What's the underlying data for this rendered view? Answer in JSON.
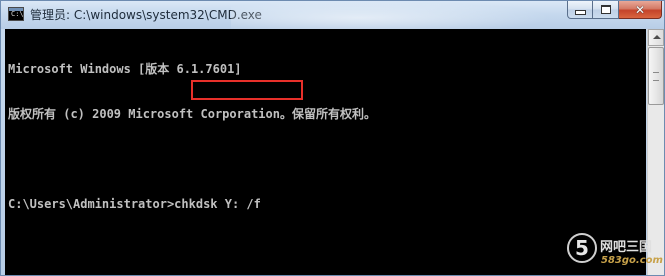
{
  "window": {
    "title": "管理员: C:\\windows\\system32\\CMD.exe",
    "icon": "cmd-icon",
    "icon_text": "C:\\"
  },
  "caption_buttons": {
    "minimize_icon": "minimize-icon",
    "maximize_icon": "maximize-icon",
    "close_icon": "close-icon",
    "close_label": "✕"
  },
  "console": {
    "lines": [
      "Microsoft Windows [版本 6.1.7601]",
      "版权所有 (c) 2009 Microsoft Corporation。保留所有权利。",
      "",
      "C:\\Users\\Administrator>chkdsk Y: /f"
    ],
    "prompt": "C:\\Users\\Administrator>",
    "command": "chkdsk Y: /f",
    "text_color": "#c0c0c0",
    "background": "#000000",
    "highlight_color": "#e8302a"
  },
  "watermark": {
    "badge": "5",
    "name": "网吧三国",
    "url": "583go.com"
  }
}
